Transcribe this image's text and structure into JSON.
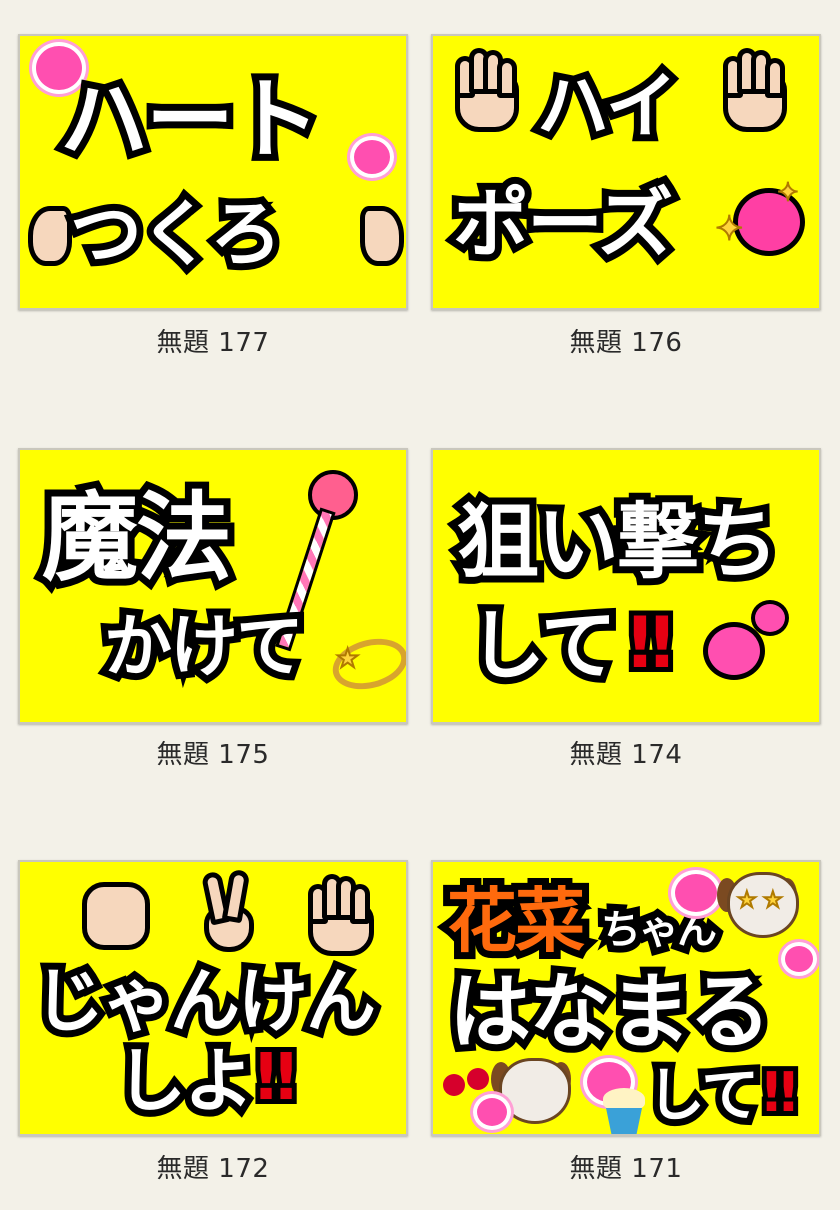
{
  "gallery": {
    "items": [
      {
        "caption": "無題 177",
        "line1": "ハート",
        "line2": "つくろ"
      },
      {
        "caption": "無題 176",
        "line1": "ハイ",
        "line2": "ポーズ"
      },
      {
        "caption": "無題 175",
        "line1": "魔法",
        "line2": "かけて"
      },
      {
        "caption": "無題 174",
        "line1": "狙い撃ち",
        "line2": "して",
        "mark": "‼"
      },
      {
        "caption": "無題 172",
        "line1": "じゃんけん",
        "line2": "しよ",
        "mark": "‼"
      },
      {
        "caption": "無題 171",
        "name": "花菜",
        "suffix": "ちゃん",
        "line1": "はなまる",
        "line2": "して",
        "mark": "‼"
      }
    ]
  },
  "colors": {
    "card_background": "#ffff00",
    "page_background": "#f3f1e8",
    "text_fill": "#ffffff",
    "text_outline": "#000000",
    "accent_orange": "#ff6a0d",
    "accent_red": "#e60012"
  },
  "icons": [
    "heart-icon",
    "hand-icon",
    "raised-hand-icon",
    "sparkling-heart-icon",
    "magic-wand-icon",
    "halo-icon",
    "two-hearts-icon",
    "fist-icon",
    "victory-hand-icon",
    "dog-face-icon",
    "cherries-icon",
    "cupcake-icon"
  ]
}
